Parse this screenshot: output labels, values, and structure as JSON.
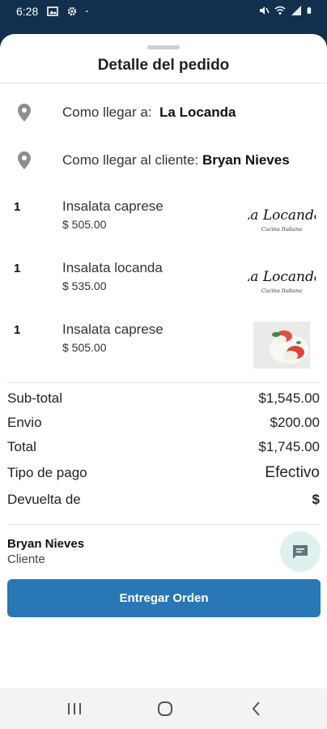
{
  "status_bar": {
    "time": "6:28",
    "left_icons": [
      "image-icon",
      "settings-icon",
      "dot-icon"
    ],
    "right_icons": [
      "mute-icon",
      "wifi-icon",
      "signal-icon",
      "battery-icon"
    ]
  },
  "sheet": {
    "title": "Detalle del pedido"
  },
  "directions": [
    {
      "label": "Como llegar a:",
      "target": "La Locanda",
      "icon": "location-pin-icon"
    },
    {
      "label": "Como llegar al cliente:",
      "target": "Bryan Nieves",
      "icon": "location-pin-icon"
    }
  ],
  "items": [
    {
      "qty": "1",
      "name": "Insalata caprese",
      "price": "$ 505.00",
      "image": "la-locanda-logo"
    },
    {
      "qty": "1",
      "name": "Insalata locanda",
      "price": "$ 535.00",
      "image": "la-locanda-logo"
    },
    {
      "qty": "1",
      "name": "Insalata caprese",
      "price": "$ 505.00",
      "image": "caprese-photo"
    }
  ],
  "logo": {
    "line1": "La Locanda",
    "line2": "Cucina Italiana"
  },
  "summary": [
    {
      "label": "Sub-total",
      "value": "$1,545.00"
    },
    {
      "label": "Envio",
      "value": "$200.00"
    },
    {
      "label": "Total",
      "value": "$1,745.00"
    },
    {
      "label": "Tipo de pago",
      "value": "Efectivo"
    },
    {
      "label": "Devuelta de",
      "value": "$"
    }
  ],
  "client": {
    "name": "Bryan Nieves",
    "role": "Cliente",
    "chat_icon": "chat-icon"
  },
  "action": {
    "label": "Entregar Orden"
  },
  "nav_bar": {
    "icons": [
      "recents-icon",
      "home-icon",
      "back-icon"
    ]
  },
  "colors": {
    "status_bg": "#12304d",
    "primary": "#2a77b6",
    "chat_bg": "#dff1ef",
    "pin": "#8e8e8e"
  }
}
